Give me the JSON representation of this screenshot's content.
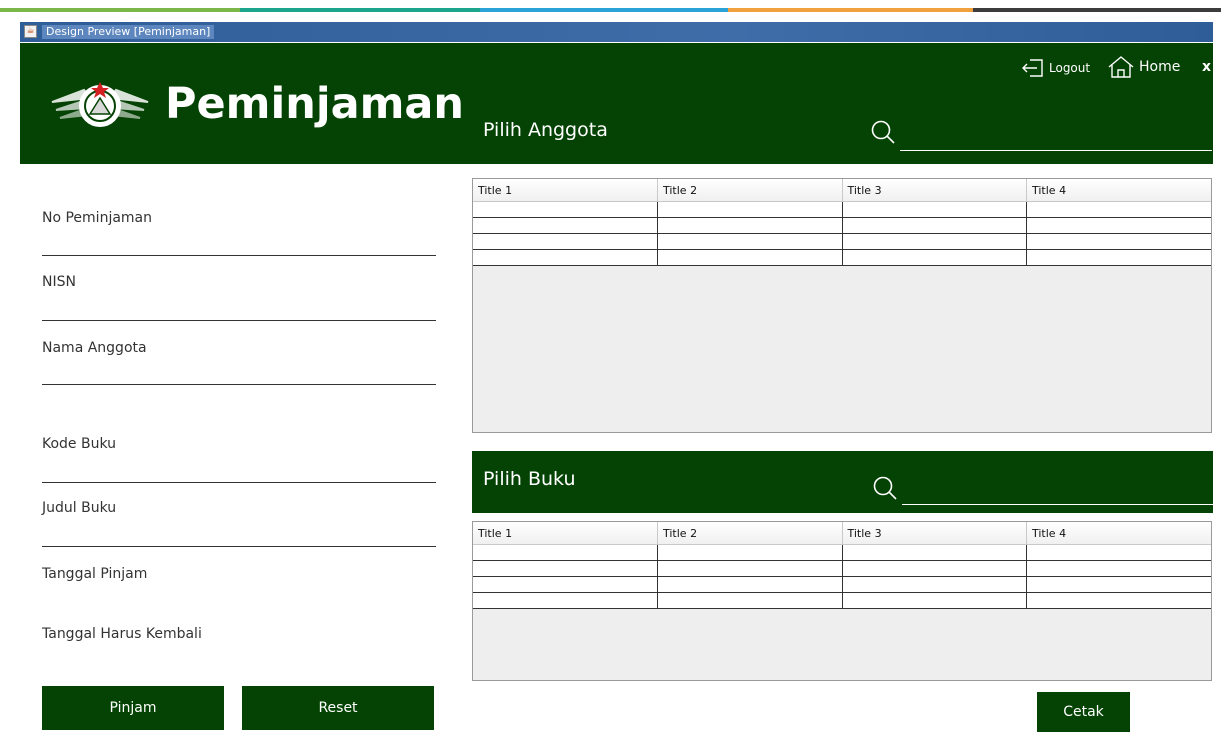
{
  "window": {
    "title": "Design Preview [Peminjaman]"
  },
  "header": {
    "title": "Peminjaman",
    "logout_label": "Logout",
    "home_label": "Home",
    "close_label": "x",
    "member_section_label": "Pilih Anggota"
  },
  "form": {
    "no_peminjaman_label": "No Peminjaman",
    "nisn_label": "NISN",
    "nama_anggota_label": "Nama Anggota",
    "kode_buku_label": "Kode Buku",
    "judul_buku_label": "Judul Buku",
    "tanggal_pinjam_label": "Tanggal Pinjam",
    "tanggal_harus_kembali_label": "Tanggal Harus Kembali"
  },
  "member_table": {
    "columns": [
      "Title 1",
      "Title 2",
      "Title 3",
      "Title 4"
    ]
  },
  "book_section": {
    "label": "Pilih Buku"
  },
  "book_table": {
    "columns": [
      "Title 1",
      "Title 2",
      "Title 3",
      "Title 4"
    ]
  },
  "buttons": {
    "pinjam": "Pinjam",
    "reset": "Reset",
    "cetak": "Cetak"
  },
  "colors": {
    "primary_green": "#044303",
    "title_bar_blue": "#2e5d97"
  },
  "icons": {
    "logout": "logout-icon",
    "home": "home-icon",
    "search": "search-icon",
    "app_logo": "emblem-logo"
  }
}
